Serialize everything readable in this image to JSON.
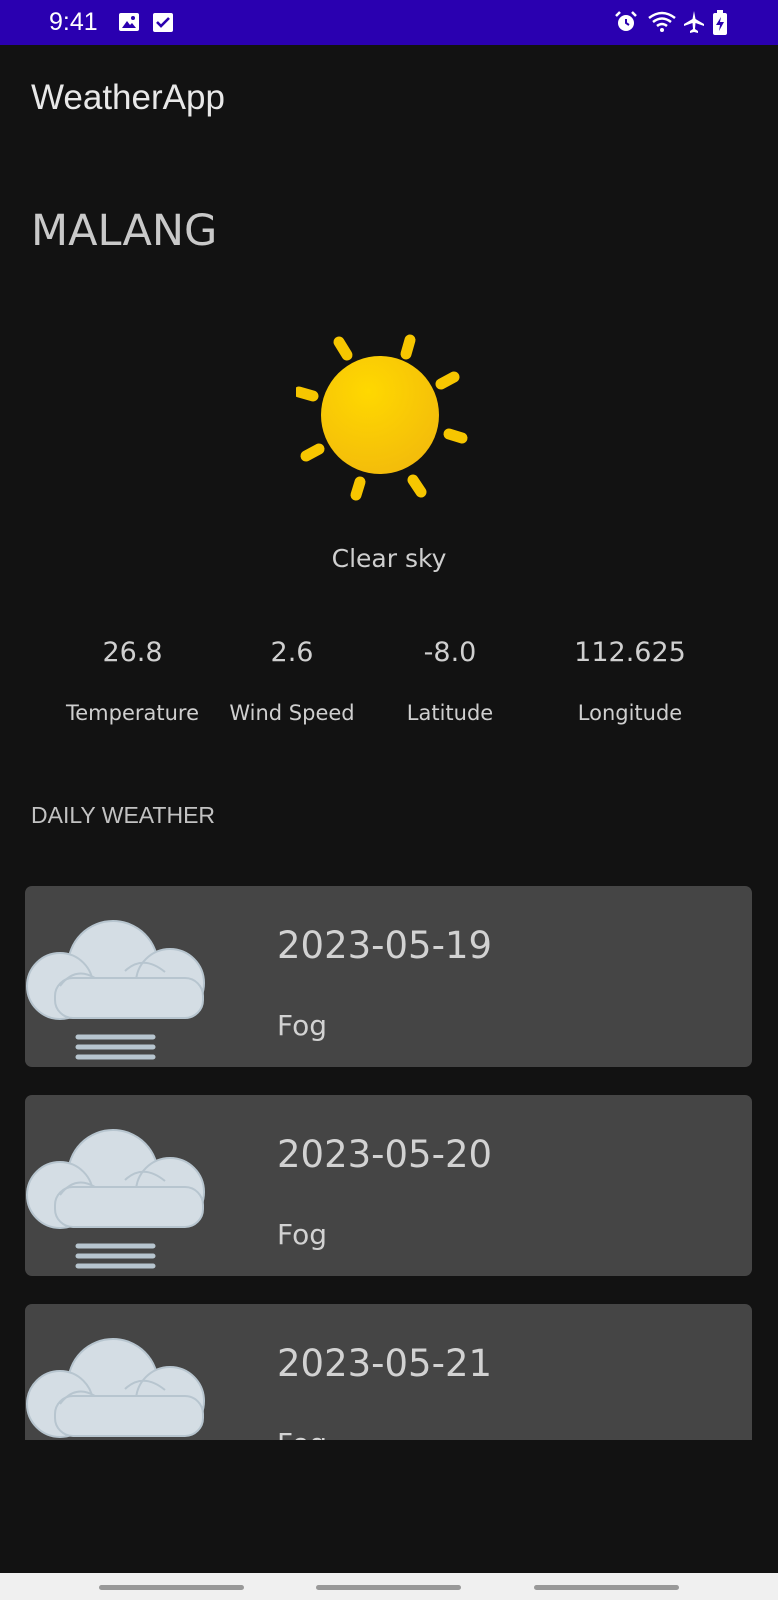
{
  "status_bar": {
    "time": "9:41",
    "left_icons": [
      "image-icon",
      "checkbox-icon"
    ],
    "right_icons": [
      "alarm-icon",
      "wifi-icon",
      "airplane-icon",
      "battery-charging-icon"
    ],
    "color": "#2a00b0"
  },
  "app": {
    "title": "WeatherApp"
  },
  "current": {
    "city": "MALANG",
    "icon": "sun-icon",
    "condition": "Clear sky",
    "metrics": [
      {
        "value": "26.8",
        "label": "Temperature"
      },
      {
        "value": "2.6",
        "label": "Wind Speed"
      },
      {
        "value": "-8.0",
        "label": "Latitude"
      },
      {
        "value": "112.625",
        "label": "Longitude"
      }
    ]
  },
  "daily": {
    "title": "DAILY WEATHER",
    "items": [
      {
        "date": "2023-05-19",
        "description": "Fog",
        "icon": "fog-icon"
      },
      {
        "date": "2023-05-20",
        "description": "Fog",
        "icon": "fog-icon"
      },
      {
        "date": "2023-05-21",
        "description": "Fog",
        "icon": "fog-icon"
      }
    ]
  },
  "colors": {
    "background": "#121212",
    "card": "#454545",
    "sun": "#f7c600"
  }
}
